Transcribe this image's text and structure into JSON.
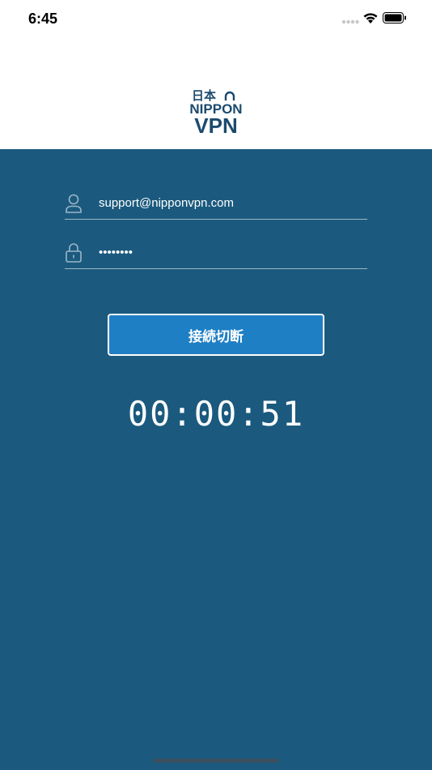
{
  "status_bar": {
    "time": "6:45",
    "icons": [
      "signal-icon",
      "wifi-icon",
      "battery-icon"
    ]
  },
  "header": {
    "logo": {
      "line1": "日本",
      "line2": "NIPPON",
      "line3": "VPN"
    }
  },
  "login": {
    "email_value": "support@nipponvpn.com",
    "password_value": "••••••••",
    "connect_button_label": "接続切断",
    "timer": "00:00:51"
  },
  "colors": {
    "background": "#1b5a7e",
    "button": "#1f7fc4",
    "logo": "#1b4a6e",
    "white": "#ffffff"
  }
}
